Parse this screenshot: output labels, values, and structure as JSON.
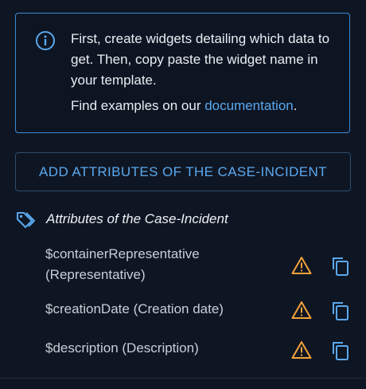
{
  "info": {
    "line1": "First, create widgets detailing which data to get. Then, copy paste the widget name in your template.",
    "line2_prefix": "Find examples on our ",
    "line2_link": "documentation",
    "line2_suffix": "."
  },
  "add_button": {
    "label": "ADD ATTRIBUTES OF THE CASE-INCIDENT"
  },
  "section": {
    "title": "Attributes of the Case-Incident"
  },
  "attributes": [
    {
      "label": "$containerRepresentative (Representative)"
    },
    {
      "label": "$creationDate (Creation date)"
    },
    {
      "label": "$description (Description)"
    }
  ],
  "colors": {
    "background": "#0f1623",
    "accent": "#5aa8ee",
    "warning": "#f2a33a",
    "border": "#3a8bd6"
  },
  "icons": {
    "info": "info-circle-icon",
    "tag": "tags-icon",
    "warning": "warning-triangle-icon",
    "copy": "copy-icon"
  }
}
